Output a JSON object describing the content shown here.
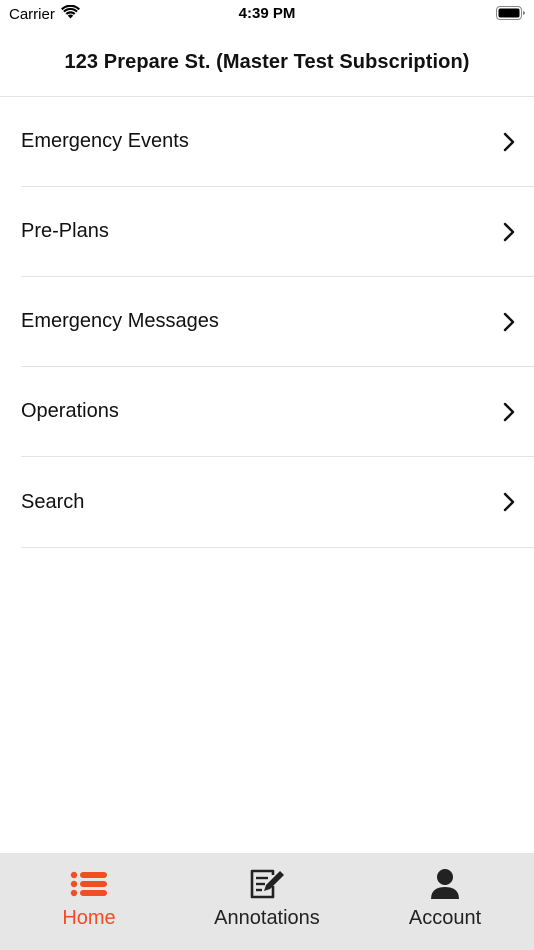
{
  "status_bar": {
    "carrier": "Carrier",
    "time": "4:39 PM"
  },
  "nav": {
    "title": "123 Prepare St. (Master Test Subscription)"
  },
  "menu": {
    "items": [
      {
        "label": "Emergency Events"
      },
      {
        "label": "Pre-Plans"
      },
      {
        "label": "Emergency Messages"
      },
      {
        "label": "Operations"
      },
      {
        "label": "Search"
      }
    ]
  },
  "tab_bar": {
    "active_color": "#f04e23",
    "inactive_color": "#222222",
    "tabs": [
      {
        "label": "Home",
        "icon": "list-icon",
        "active": true
      },
      {
        "label": "Annotations",
        "icon": "edit-note-icon",
        "active": false
      },
      {
        "label": "Account",
        "icon": "person-icon",
        "active": false
      }
    ]
  }
}
